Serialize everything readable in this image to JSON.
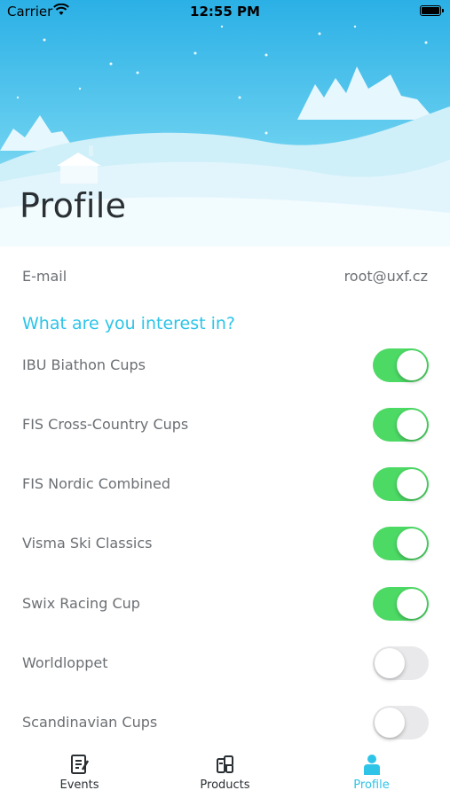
{
  "status_bar": {
    "carrier": "Carrier",
    "time": "12:55 PM"
  },
  "header": {
    "title": "Profile"
  },
  "profile": {
    "email_label": "E-mail",
    "email_value": "root@uxf.cz",
    "interest_title": "What are you interest in?",
    "interests": [
      {
        "label": "IBU Biathon Cups",
        "enabled": true
      },
      {
        "label": "FIS Cross-Country Cups",
        "enabled": true
      },
      {
        "label": "FIS Nordic Combined",
        "enabled": true
      },
      {
        "label": "Visma Ski Classics",
        "enabled": true
      },
      {
        "label": "Swix Racing Cup",
        "enabled": true
      },
      {
        "label": "Worldloppet",
        "enabled": false
      },
      {
        "label": "Scandinavian Cups",
        "enabled": false
      }
    ]
  },
  "tabs": [
    {
      "label": "Events",
      "icon": "events-icon",
      "active": false
    },
    {
      "label": "Products",
      "icon": "products-icon",
      "active": false
    },
    {
      "label": "Profile",
      "icon": "profile-icon",
      "active": true
    }
  ],
  "colors": {
    "accent": "#2ec4e8",
    "toggle_on": "#4cd964",
    "toggle_off": "#e9e9eb"
  }
}
